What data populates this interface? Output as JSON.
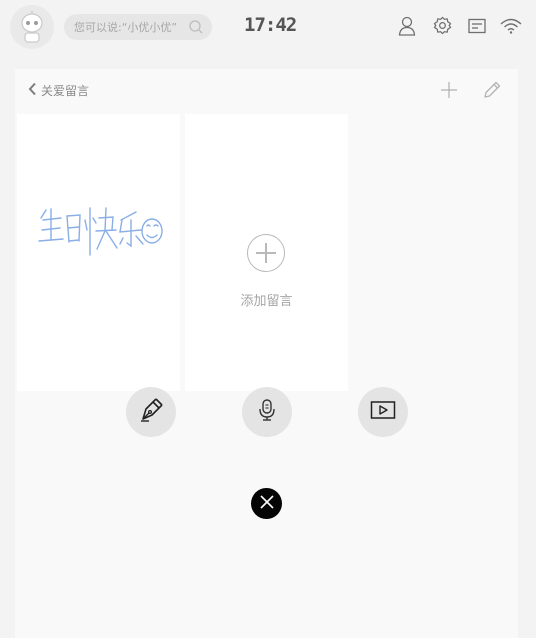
{
  "status_bar": {
    "search_placeholder": "您可以说:“小优小优”",
    "time": "17:42",
    "icons": [
      "robot-avatar-icon",
      "search-icon",
      "user-icon",
      "gear-icon",
      "message-icon",
      "wifi-icon"
    ]
  },
  "header": {
    "back_label": "关爱留言"
  },
  "cards": [
    {
      "type": "handwritten-note",
      "content": "生日快乐"
    },
    {
      "type": "add",
      "label": "添加留言"
    }
  ],
  "actions": [
    "pen-icon",
    "microphone-icon",
    "video-icon"
  ],
  "colors": {
    "handwriting": "#8aaee6",
    "background": "#f3f3f3",
    "panel": "#f9f9f9",
    "card": "#ffffff"
  }
}
